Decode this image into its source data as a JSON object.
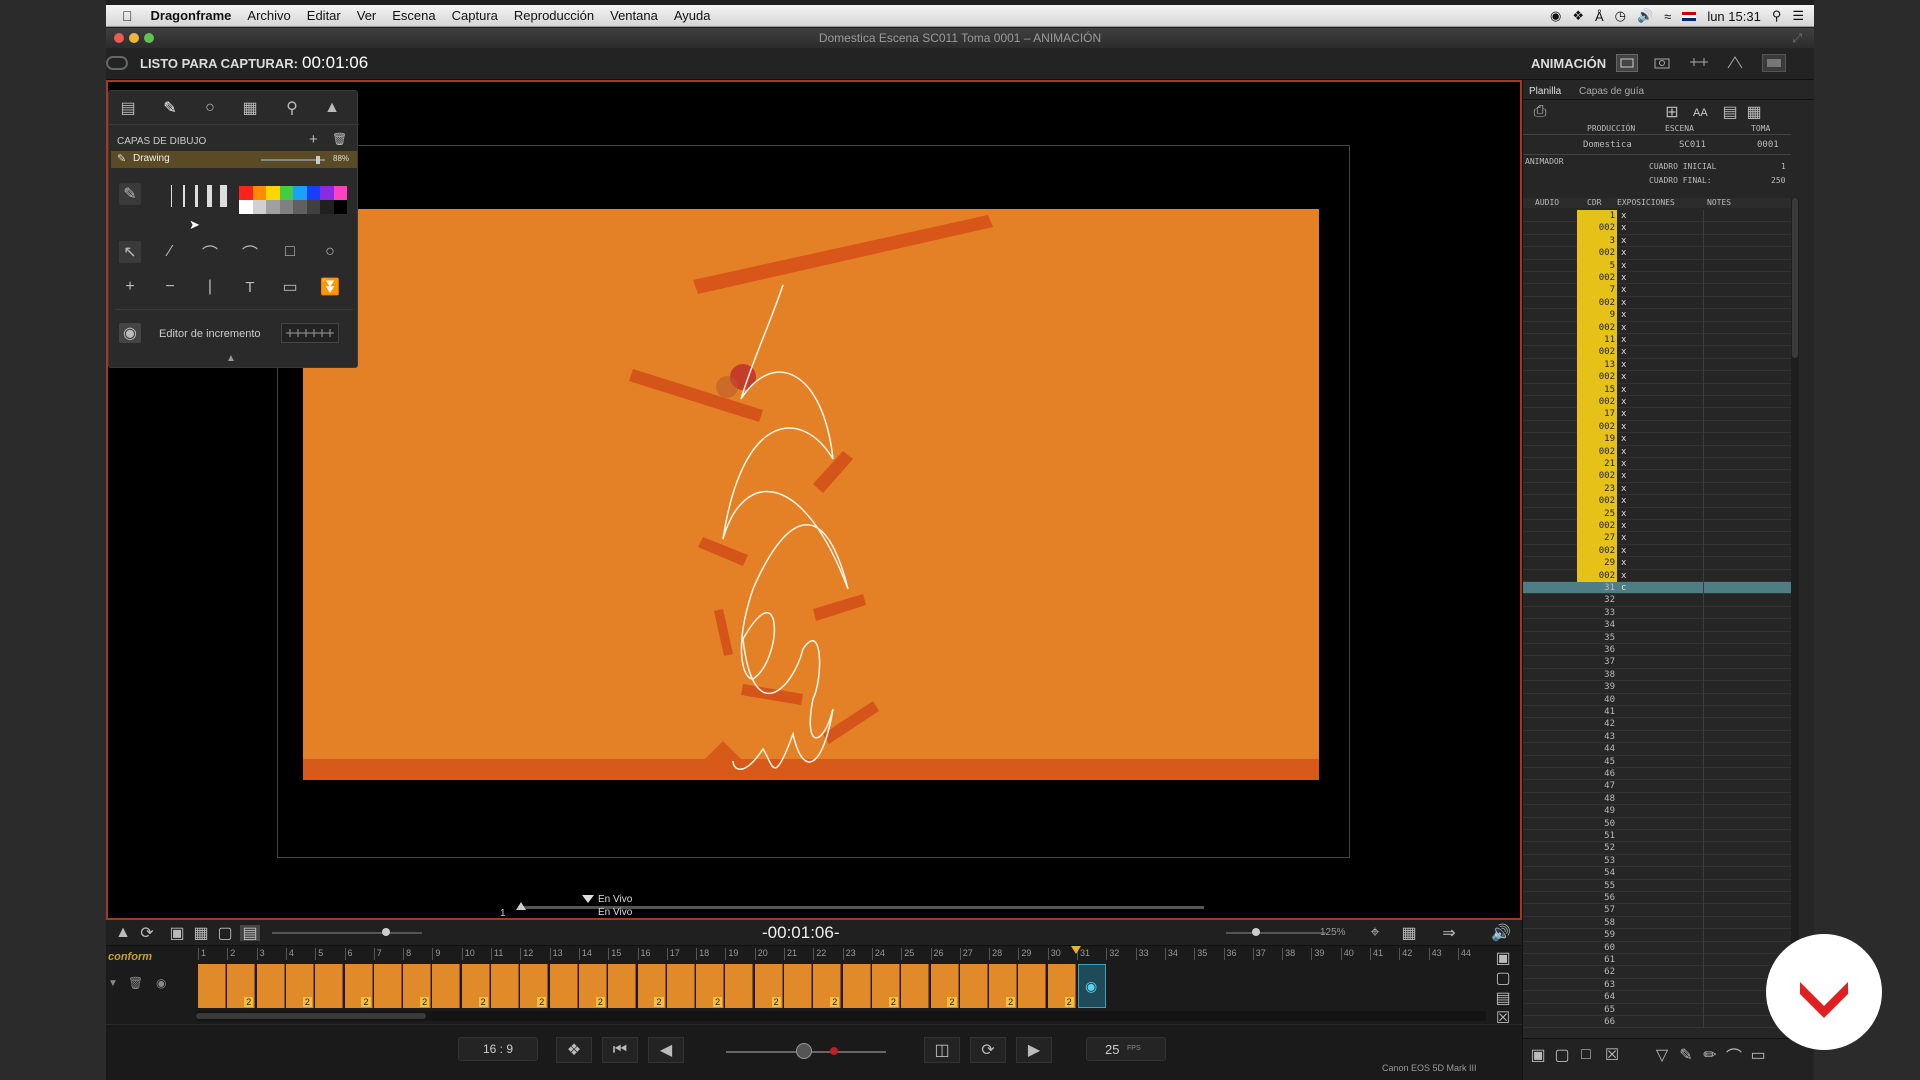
{
  "menubar": {
    "apple": "",
    "app": "Dragonframe",
    "items": [
      "Archivo",
      "Editar",
      "Ver",
      "Escena",
      "Captura",
      "Reproducción",
      "Ventana",
      "Ayuda"
    ],
    "clock": "lun 15:31"
  },
  "window": {
    "title": "Domestica  Escena SC011  Toma 0001 – ANIMACIÓN"
  },
  "toolbar": {
    "status_label": "LISTO PARA CAPTURAR:",
    "status_time": "00:01:06",
    "mode_label": "ANIMACIÓN"
  },
  "drawpanel": {
    "layers_title": "CAPAS DE DIBUJO",
    "layer_name": "Drawing",
    "layer_opacity": "88%",
    "layer_opacity_value": 0.88,
    "increment_label": "Editor de incremento",
    "palette": [
      "#ff2020",
      "#ff8c00",
      "#ffd700",
      "#44cc44",
      "#1aa0ff",
      "#1a3cff",
      "#8a2be2",
      "#ff40c0",
      "#ffffff",
      "#d0d0d0",
      "#a0a0a0",
      "#808080",
      "#606060",
      "#404040",
      "#202020",
      "#000000"
    ]
  },
  "viewer": {
    "live_top": "En Vivo",
    "live_bottom": "En Vivo",
    "frame_start": "1",
    "timecode": "-00:01:06-",
    "zoom": "125%"
  },
  "timeline": {
    "track_label": "conform",
    "ticks": [
      "1",
      "2",
      "3",
      "4",
      "5",
      "6",
      "7",
      "8",
      "9",
      "10",
      "11",
      "12",
      "13",
      "14",
      "15",
      "16",
      "17",
      "18",
      "19",
      "20",
      "21",
      "22",
      "23",
      "24",
      "25",
      "26",
      "27",
      "28",
      "29",
      "30",
      "31",
      "32",
      "33",
      "34",
      "35",
      "36",
      "37",
      "38",
      "39",
      "40",
      "41",
      "42",
      "43",
      "44"
    ],
    "frame_count": 30,
    "hold_label": "2"
  },
  "transport": {
    "aspect": "16 : 9",
    "fps_value": "25",
    "fps_unit": "FPS",
    "camera": "Canon EOS 5D Mark III"
  },
  "xsheet": {
    "tab_sheet": "Planilla",
    "tab_guides": "Capas de guía",
    "text_size": "AA",
    "h_production": "PRODUCCIÓN",
    "h_scene": "ESCENA",
    "h_take": "TOMA",
    "production": "Domestica",
    "scene": "SC011",
    "take": "0001",
    "h_animator": "ANIMADOR",
    "first_frame_label": "CUADRO INICIAL",
    "first_frame": "1",
    "last_frame_label": "CUADRO FINAL:",
    "last_frame": "250",
    "c_audio": "AUDIO",
    "c_frame": "CDR",
    "c_exposures": "EXPOSICIONES",
    "c_notes": "NOTES"
  }
}
